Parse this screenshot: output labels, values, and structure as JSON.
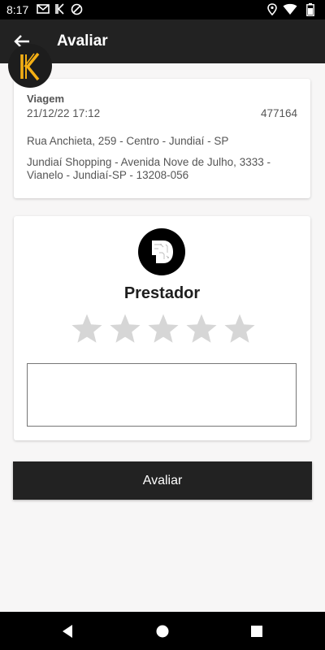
{
  "status_bar": {
    "time": "8:17",
    "icons": [
      "gmail-icon",
      "app-k-icon",
      "vpn-icon",
      "location-icon",
      "wifi-icon",
      "battery-icon"
    ]
  },
  "app_bar": {
    "title": "Avaliar",
    "back_icon": "arrow-left-icon"
  },
  "trip": {
    "label": "Viagem",
    "datetime": "21/12/22 17:12",
    "id": "477164",
    "origin": "Rua Anchieta, 259 - Centro - Jundiaí - SP",
    "destination": "Jundiaí Shopping - Avenida Nove de Julho, 3333 - Vianelo - Jundiaí-SP - 13208-056"
  },
  "rating": {
    "provider_name": "Prestador",
    "stars_total": 5,
    "stars_selected": 0,
    "comment_value": "",
    "comment_placeholder": ""
  },
  "submit_label": "Avaliar",
  "colors": {
    "primary": "#222222",
    "accent": "#f5b014",
    "star_inactive": "#d6d6d6",
    "background": "#f7f6f6"
  },
  "nav_bar": {
    "icons": [
      "back-triangle-icon",
      "home-circle-icon",
      "recents-square-icon"
    ]
  }
}
